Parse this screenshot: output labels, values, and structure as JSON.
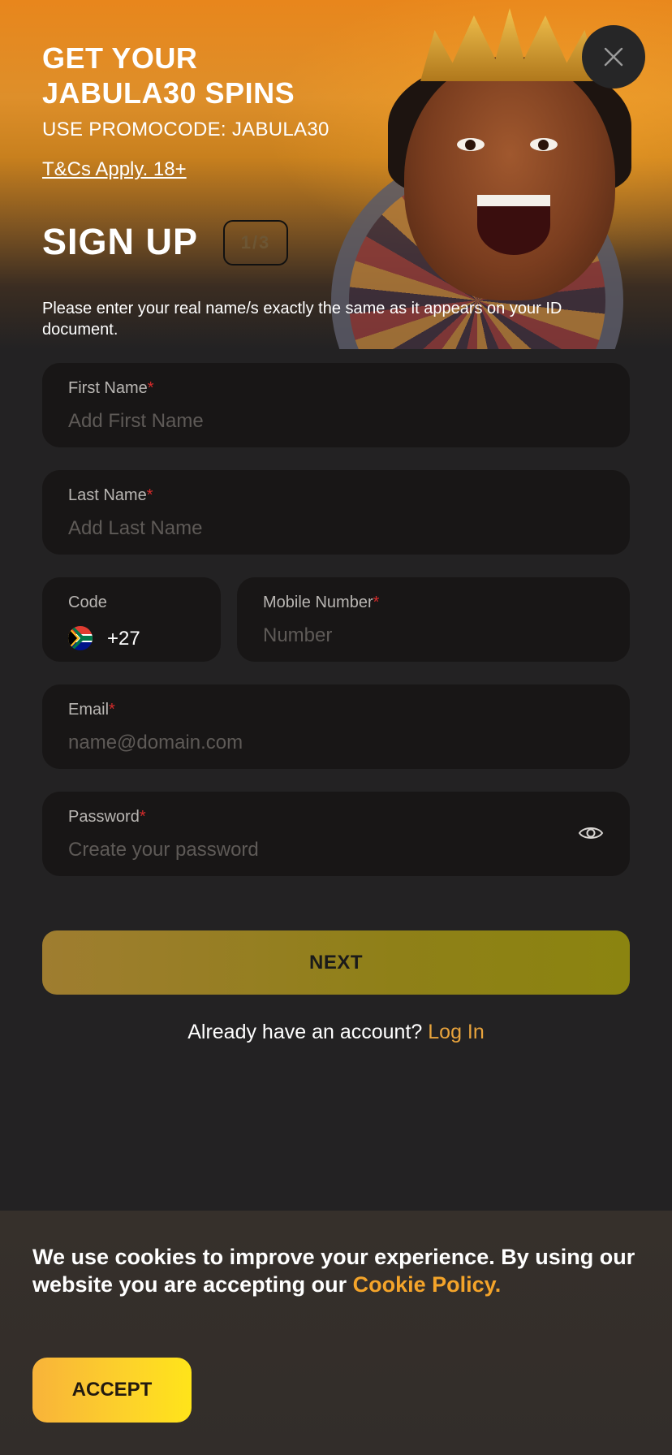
{
  "promo": {
    "title_line1": "GET YOUR",
    "title_line2": "JABULA30 SPINS",
    "code_text": "USE PROMOCODE: JABULA30",
    "terms_link": "T&Cs Apply. 18+"
  },
  "signup": {
    "title": "SIGN UP",
    "step": "1/3",
    "info": "Please enter your real name/s exactly the same as it appears on your ID document."
  },
  "form": {
    "first_name": {
      "label": "First Name",
      "required_mark": "*",
      "placeholder": "Add First Name"
    },
    "last_name": {
      "label": "Last Name",
      "required_mark": "*",
      "placeholder": "Add Last Name"
    },
    "code": {
      "label": "Code",
      "value": "+27",
      "flag_icon": "south-africa-flag-icon"
    },
    "mobile": {
      "label": "Mobile Number",
      "required_mark": "*",
      "placeholder": "Number"
    },
    "email": {
      "label": "Email",
      "required_mark": "*",
      "placeholder": "name@domain.com"
    },
    "password": {
      "label": "Password",
      "required_mark": "*",
      "placeholder": "Create your password",
      "toggle_icon": "eye-icon"
    },
    "next_label": "NEXT"
  },
  "login": {
    "prompt": "Already have an account?",
    "link": "Log In"
  },
  "cookie": {
    "text": "We use cookies to improve your experience. By using our website you are accepting our",
    "link": "Cookie Policy.",
    "accept_label": "ACCEPT"
  },
  "colors": {
    "accent": "#e8a33c",
    "required": "#d42b2b",
    "background": "#232223",
    "field_bg": "#181616"
  }
}
